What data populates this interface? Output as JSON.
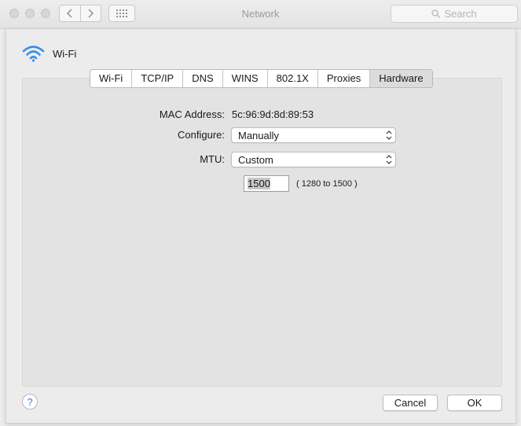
{
  "window": {
    "title": "Network",
    "search_placeholder": "Search"
  },
  "service": {
    "name": "Wi-Fi",
    "icon": "wifi-icon",
    "icon_color": "#3a8ee6"
  },
  "tabs": [
    {
      "label": "Wi-Fi",
      "active": false
    },
    {
      "label": "TCP/IP",
      "active": false
    },
    {
      "label": "DNS",
      "active": false
    },
    {
      "label": "WINS",
      "active": false
    },
    {
      "label": "802.1X",
      "active": false
    },
    {
      "label": "Proxies",
      "active": false
    },
    {
      "label": "Hardware",
      "active": true
    }
  ],
  "hardware": {
    "mac_label": "MAC Address:",
    "mac_value": "5c:96:9d:8d:89:53",
    "configure_label": "Configure:",
    "configure_value": "Manually",
    "mtu_label": "MTU:",
    "mtu_value": "Custom",
    "mtu_field_value": "1500",
    "mtu_range": "( 1280 to 1500 )"
  },
  "footer": {
    "help": "?",
    "cancel": "Cancel",
    "ok": "OK"
  }
}
